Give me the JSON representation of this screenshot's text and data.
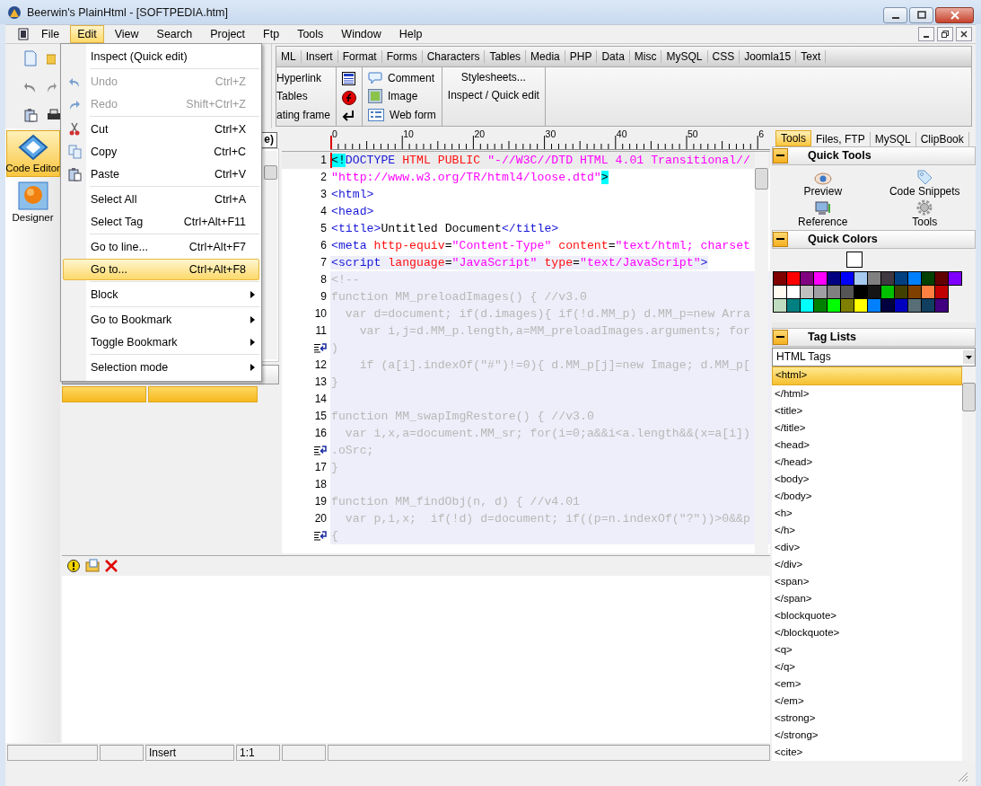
{
  "window": {
    "title": "Beerwin's PlainHtml - [SOFTPEDIA.htm]"
  },
  "menu_bar": [
    {
      "label": "File",
      "selected": false
    },
    {
      "label": "Edit",
      "selected": true
    },
    {
      "label": "View",
      "selected": false
    },
    {
      "label": "Search",
      "selected": false
    },
    {
      "label": "Project",
      "selected": false
    },
    {
      "label": "Ftp",
      "selected": false
    },
    {
      "label": "Tools",
      "selected": false
    },
    {
      "label": "Window",
      "selected": false
    },
    {
      "label": "Help",
      "selected": false
    }
  ],
  "edit_menu": [
    {
      "kind": "item",
      "label": "Inspect (Quick edit)",
      "disabled": false,
      "selected": false,
      "submenu": false
    },
    {
      "kind": "separator"
    },
    {
      "kind": "item",
      "label": "Undo",
      "shortcut": "Ctrl+Z",
      "disabled": true,
      "selected": false,
      "submenu": false
    },
    {
      "kind": "item",
      "label": "Redo",
      "shortcut": "Shift+Ctrl+Z",
      "disabled": true,
      "selected": false,
      "submenu": false
    },
    {
      "kind": "separator"
    },
    {
      "kind": "item",
      "label": "Cut",
      "shortcut": "Ctrl+X",
      "disabled": false,
      "selected": false,
      "submenu": false
    },
    {
      "kind": "item",
      "label": "Copy",
      "shortcut": "Ctrl+C",
      "disabled": false,
      "selected": false,
      "submenu": false
    },
    {
      "kind": "item",
      "label": "Paste",
      "shortcut": "Ctrl+V",
      "disabled": false,
      "selected": false,
      "submenu": false
    },
    {
      "kind": "separator"
    },
    {
      "kind": "item",
      "label": "Select All",
      "shortcut": "Ctrl+A",
      "disabled": false,
      "selected": false,
      "submenu": false
    },
    {
      "kind": "item",
      "label": "Select Tag",
      "shortcut": "Ctrl+Alt+F11",
      "disabled": false,
      "selected": false,
      "submenu": false
    },
    {
      "kind": "separator"
    },
    {
      "kind": "item",
      "label": "Go to line...",
      "shortcut": "Ctrl+Alt+F7",
      "disabled": false,
      "selected": false,
      "submenu": false
    },
    {
      "kind": "item",
      "label": "Go to...",
      "shortcut": "Ctrl+Alt+F8",
      "disabled": false,
      "selected": true,
      "submenu": false
    },
    {
      "kind": "separator"
    },
    {
      "kind": "item",
      "label": "Block",
      "disabled": false,
      "selected": false,
      "submenu": true
    },
    {
      "kind": "separator"
    },
    {
      "kind": "item",
      "label": "Go to Bookmark",
      "disabled": false,
      "selected": false,
      "submenu": true
    },
    {
      "kind": "item",
      "label": "Toggle Bookmark",
      "disabled": false,
      "selected": false,
      "submenu": true
    },
    {
      "kind": "separator"
    },
    {
      "kind": "item",
      "label": "Selection mode",
      "disabled": false,
      "selected": false,
      "submenu": true
    }
  ],
  "ribbon": {
    "tabs": [
      "ML",
      "Insert",
      "Format",
      "Forms",
      "Characters",
      "Tables",
      "Media",
      "PHP",
      "Data",
      "Misc",
      "MySQL",
      "CSS",
      "Joomla15",
      "Text"
    ],
    "groups": [
      {
        "kind": "labels",
        "items": [
          "Hyperlink",
          "Tables",
          "ating frame"
        ]
      },
      {
        "kind": "icons"
      },
      {
        "kind": "icon-labels",
        "items": [
          "Comment",
          "Image",
          "Web form"
        ]
      },
      {
        "kind": "labels",
        "items": [
          "Stylesheets...",
          "Inspect / Quick edit"
        ]
      }
    ]
  },
  "view_switcher": [
    {
      "label": "Code Editor",
      "selected": true
    },
    {
      "label": "Designer",
      "selected": false
    }
  ],
  "left_panel": {
    "tab": "e)"
  },
  "ruler_labels": [
    "0",
    "10",
    "20",
    "30",
    "40",
    "50",
    "6"
  ],
  "editor": {
    "lines": [
      {
        "number": "1",
        "wrapped": false,
        "current": true,
        "kind": "markup",
        "segments": [
          {
            "text": "<!",
            "kind": "hl"
          },
          {
            "text": "DOCTYPE",
            "kind": "tag"
          },
          {
            "text": " HTML PUBLIC ",
            "kind": "attr"
          },
          {
            "text": "\"-//W3C//DTD HTML 4.01 Transitional//",
            "kind": "str"
          }
        ]
      },
      {
        "number": "2",
        "wrapped": false,
        "current": false,
        "kind": "markup",
        "segments": [
          {
            "text": "\"http://www.w3.org/TR/html4/loose.dtd\"",
            "kind": "str"
          },
          {
            "text": ">",
            "kind": "hl"
          }
        ]
      },
      {
        "number": "3",
        "wrapped": false,
        "current": false,
        "kind": "markup",
        "segments": [
          {
            "text": "<html>",
            "kind": "tag"
          }
        ]
      },
      {
        "number": "4",
        "wrapped": false,
        "current": false,
        "kind": "markup",
        "segments": [
          {
            "text": "<head>",
            "kind": "tag"
          }
        ]
      },
      {
        "number": "5",
        "wrapped": false,
        "current": false,
        "kind": "markup",
        "segments": [
          {
            "text": "<title>",
            "kind": "tag"
          },
          {
            "text": "Untitled Document",
            "kind": "txt"
          },
          {
            "text": "</title>",
            "kind": "tag"
          }
        ]
      },
      {
        "number": "6",
        "wrapped": false,
        "current": false,
        "kind": "markup",
        "segments": [
          {
            "text": "<meta",
            "kind": "tag"
          },
          {
            "text": " http-equiv",
            "kind": "attr"
          },
          {
            "text": "=",
            "kind": "txt"
          },
          {
            "text": "\"Content-Type\"",
            "kind": "str"
          },
          {
            "text": " content",
            "kind": "attr"
          },
          {
            "text": "=",
            "kind": "txt"
          },
          {
            "text": "\"text/html; charset",
            "kind": "str"
          }
        ]
      },
      {
        "number": "7",
        "wrapped": false,
        "current": false,
        "kind": "script-tag",
        "segments": [
          {
            "text": "<script",
            "kind": "tag"
          },
          {
            "text": " language",
            "kind": "attr"
          },
          {
            "text": "=",
            "kind": "txt"
          },
          {
            "text": "\"JavaScript\"",
            "kind": "str"
          },
          {
            "text": " type",
            "kind": "attr"
          },
          {
            "text": "=",
            "kind": "txt"
          },
          {
            "text": "\"text/JavaScript\"",
            "kind": "str"
          },
          {
            "text": ">",
            "kind": "tag"
          }
        ]
      },
      {
        "number": "8",
        "wrapped": false,
        "current": false,
        "kind": "script",
        "segments": [
          {
            "text": "<!--",
            "kind": "cmt"
          }
        ]
      },
      {
        "number": "9",
        "wrapped": false,
        "current": false,
        "kind": "script",
        "segments": [
          {
            "text": "function MM_preloadImages() { //v3.0",
            "kind": "cmt"
          }
        ]
      },
      {
        "number": "10",
        "wrapped": false,
        "current": false,
        "kind": "script",
        "segments": [
          {
            "text": "  var d=document; if(d.images){ if(!d.MM_p) d.MM_p=new Arra",
            "kind": "cmt"
          }
        ]
      },
      {
        "number": "11",
        "wrapped": false,
        "current": false,
        "kind": "script",
        "segments": [
          {
            "text": "    var i,j=d.MM_p.length,a=MM_preloadImages.arguments; for",
            "kind": "cmt"
          }
        ]
      },
      {
        "wrapped": true,
        "current": false,
        "kind": "script",
        "segments": [
          {
            "text": ")",
            "kind": "cmt"
          }
        ]
      },
      {
        "number": "12",
        "wrapped": false,
        "current": false,
        "kind": "script",
        "segments": [
          {
            "text": "    if (a[i].indexOf(\"#\")!=0){ d.MM_p[j]=new Image; d.MM_p[",
            "kind": "cmt"
          }
        ]
      },
      {
        "number": "13",
        "wrapped": false,
        "current": false,
        "kind": "script",
        "segments": [
          {
            "text": "}",
            "kind": "cmt"
          }
        ]
      },
      {
        "number": "14",
        "wrapped": false,
        "current": false,
        "kind": "script"
      },
      {
        "number": "15",
        "wrapped": false,
        "current": false,
        "kind": "script",
        "segments": [
          {
            "text": "function MM_swapImgRestore() { //v3.0",
            "kind": "cmt"
          }
        ]
      },
      {
        "number": "16",
        "wrapped": false,
        "current": false,
        "kind": "script",
        "segments": [
          {
            "text": "  var i,x,a=document.MM_sr; for(i=0;a&&i<a.length&&(x=a[i])",
            "kind": "cmt"
          }
        ]
      },
      {
        "wrapped": true,
        "current": false,
        "kind": "script",
        "segments": [
          {
            "text": ".oSrc;",
            "kind": "cmt"
          }
        ]
      },
      {
        "number": "17",
        "wrapped": false,
        "current": false,
        "kind": "script",
        "segments": [
          {
            "text": "}",
            "kind": "cmt"
          }
        ]
      },
      {
        "number": "18",
        "wrapped": false,
        "current": false,
        "kind": "script"
      },
      {
        "number": "19",
        "wrapped": false,
        "current": false,
        "kind": "script",
        "segments": [
          {
            "text": "function MM_findObj(n, d) { //v4.01",
            "kind": "cmt"
          }
        ]
      },
      {
        "number": "20",
        "wrapped": false,
        "current": false,
        "kind": "script",
        "segments": [
          {
            "text": "  var p,i,x;  if(!d) d=document; if((p=n.indexOf(\"?\"))>0&&p",
            "kind": "cmt"
          }
        ]
      },
      {
        "wrapped": true,
        "current": false,
        "kind": "script",
        "segments": [
          {
            "text": "{",
            "kind": "cmt"
          }
        ]
      }
    ]
  },
  "right_panel": {
    "tabs": [
      {
        "label": "Tools",
        "selected": true
      },
      {
        "label": "Files, FTP",
        "selected": false
      },
      {
        "label": "MySQL",
        "selected": false
      },
      {
        "label": "ClipBook",
        "selected": false
      }
    ],
    "quick_tools": {
      "title": "Quick Tools",
      "items": [
        "Preview",
        "Code Snippets",
        "Reference",
        "Tools"
      ]
    },
    "quick_colors": {
      "title": "Quick Colors",
      "current": {
        "color": "#ffffff"
      },
      "rows": [
        [
          {
            "color": "#800000"
          },
          {
            "color": "#ff0000"
          },
          {
            "color": "#800080"
          },
          {
            "color": "#ff00ff"
          },
          {
            "color": "#000080"
          },
          {
            "color": "#0000ff"
          },
          {
            "color": "#a6caf0"
          },
          {
            "color": "#808080"
          },
          {
            "color": "#403840"
          },
          {
            "color": "#004080"
          },
          {
            "color": "#0080ff"
          },
          {
            "color": "#004000"
          },
          {
            "color": "#600000"
          },
          {
            "color": "#8000ff"
          }
        ],
        [
          {
            "color": "#fffbf0"
          },
          {
            "color": "#ffffff"
          },
          {
            "color": "#c0c0c0"
          },
          {
            "color": "#a0a0a4"
          },
          {
            "color": "#808080"
          },
          {
            "color": "#555555"
          },
          {
            "color": "#000000"
          },
          {
            "color": "#151515"
          },
          {
            "color": "#00c000"
          },
          {
            "color": "#404000"
          },
          {
            "color": "#804000"
          },
          {
            "color": "#ff8040"
          },
          {
            "color": "#c00000"
          }
        ],
        [
          {
            "color": "#c0dcc0"
          },
          {
            "color": "#008080"
          },
          {
            "color": "#00ffff"
          },
          {
            "color": "#008000"
          },
          {
            "color": "#00ff00"
          },
          {
            "color": "#808000"
          },
          {
            "color": "#ffff00"
          },
          {
            "color": "#0080ff"
          },
          {
            "color": "#000040"
          },
          {
            "color": "#0000c0"
          },
          {
            "color": "#586f78"
          },
          {
            "color": "#103f60"
          },
          {
            "color": "#400080"
          }
        ]
      ]
    },
    "tag_lists": {
      "title": "Tag Lists",
      "dropdown": "HTML Tags",
      "tags": [
        {
          "label": "<html>",
          "selected": true
        },
        {
          "label": "</html>",
          "selected": false
        },
        {
          "label": "<title>",
          "selected": false
        },
        {
          "label": "</title>",
          "selected": false
        },
        {
          "label": "<head>",
          "selected": false
        },
        {
          "label": "</head>",
          "selected": false
        },
        {
          "label": "<body>",
          "selected": false
        },
        {
          "label": "</body>",
          "selected": false
        },
        {
          "label": "<h>",
          "selected": false
        },
        {
          "label": "</h>",
          "selected": false
        },
        {
          "label": "<div>",
          "selected": false
        },
        {
          "label": "</div>",
          "selected": false
        },
        {
          "label": "<span>",
          "selected": false
        },
        {
          "label": "</span>",
          "selected": false
        },
        {
          "label": "<blockquote>",
          "selected": false
        },
        {
          "label": "</blockquote>",
          "selected": false
        },
        {
          "label": "<q>",
          "selected": false
        },
        {
          "label": "</q>",
          "selected": false
        },
        {
          "label": "<em>",
          "selected": false
        },
        {
          "label": "</em>",
          "selected": false
        },
        {
          "label": "<strong>",
          "selected": false
        },
        {
          "label": "</strong>",
          "selected": false
        },
        {
          "label": "<cite>",
          "selected": false
        }
      ]
    }
  },
  "status_bar": {
    "mode": "Insert",
    "position": "1:1"
  }
}
